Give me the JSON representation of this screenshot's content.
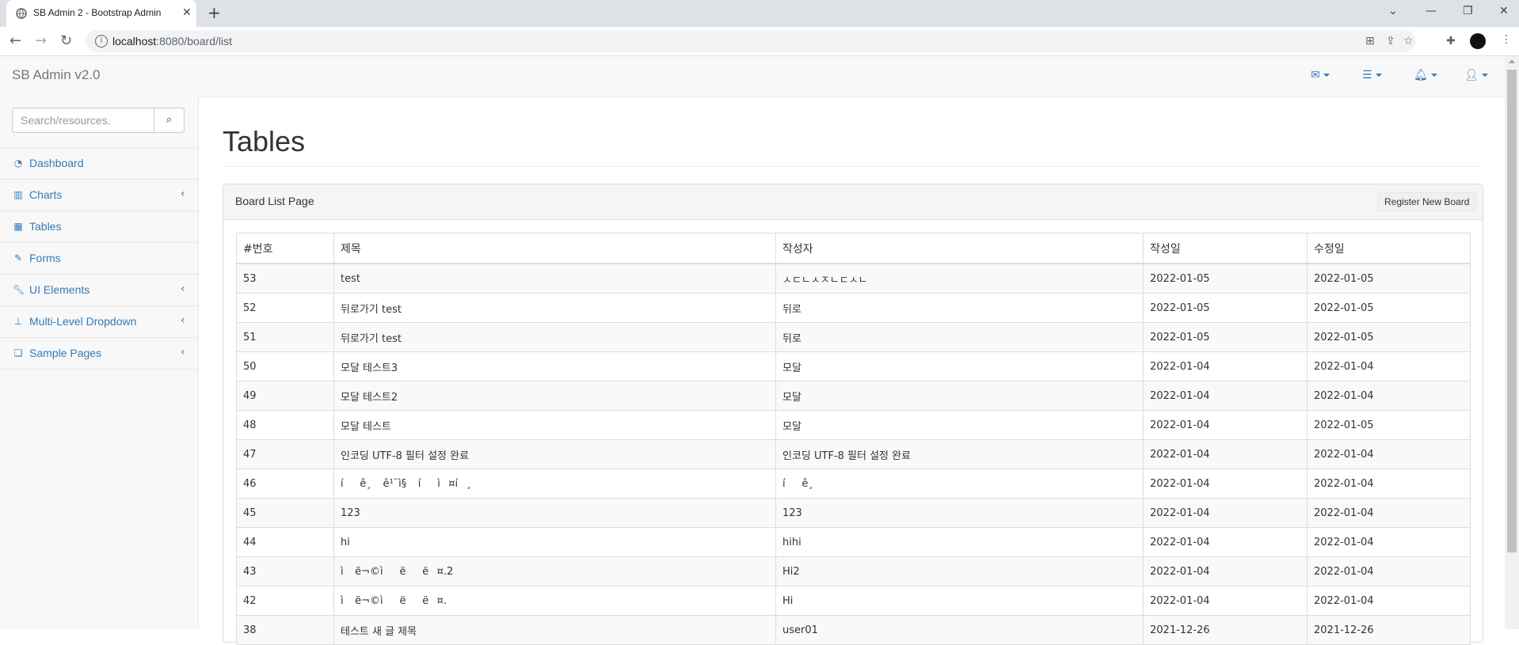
{
  "browser": {
    "tab_title": "SB Admin 2 - Bootstrap Admin",
    "url": "localhost:8080/board/list",
    "url_host": "localhost",
    "url_rest": ":8080/board/list"
  },
  "navbar": {
    "brand": "SB Admin v2.0",
    "icons": [
      "envelope-icon",
      "tasks-icon",
      "bell-icon",
      "user-icon"
    ]
  },
  "sidebar": {
    "search_placeholder": "Search/resources.",
    "items": [
      {
        "label": "Dashboard",
        "icon": "dashboard-icon",
        "has_arrow": false
      },
      {
        "label": "Charts",
        "icon": "bar-chart-icon",
        "has_arrow": true
      },
      {
        "label": "Tables",
        "icon": "table-icon",
        "has_arrow": false
      },
      {
        "label": "Forms",
        "icon": "edit-icon",
        "has_arrow": false
      },
      {
        "label": "UI Elements",
        "icon": "wrench-icon",
        "has_arrow": true
      },
      {
        "label": "Multi-Level Dropdown",
        "icon": "sitemap-icon",
        "has_arrow": true
      },
      {
        "label": "Sample Pages",
        "icon": "files-icon",
        "has_arrow": true
      }
    ]
  },
  "main": {
    "title": "Tables",
    "panel_title": "Board List Page",
    "register_button": "Register New Board",
    "table": {
      "headers": [
        "#번호",
        "제목",
        "작성자",
        "작성일",
        "수정일"
      ],
      "rows": [
        [
          "53",
          "test",
          "ㅅㄷㄴㅅㅈㄴㄷㅅㄴ",
          "2022-01-05",
          "2022-01-05"
        ],
        [
          "52",
          "뒤로가기 test",
          "뒤로",
          "2022-01-05",
          "2022-01-05"
        ],
        [
          "51",
          "뒤로가기 test",
          "뒤로",
          "2022-01-05",
          "2022-01-05"
        ],
        [
          "50",
          "모달 테스트3",
          "모달",
          "2022-01-04",
          "2022-01-04"
        ],
        [
          "49",
          "모달 테스트2",
          "모달",
          "2022-01-04",
          "2022-01-04"
        ],
        [
          "48",
          "모달 테스트",
          "모달",
          "2022-01-04",
          "2022-01-05"
        ],
        [
          "47",
          "인코딩 UTF-8 필터 설정 완료",
          "인코딩 UTF-8 필터 설정 완료",
          "2022-01-04",
          "2022-01-04"
        ],
        [
          "46",
          "íê¸ ê¹¨ì§ íì¤í¸",
          "íê¸",
          "2022-01-04",
          "2022-01-04"
        ],
        [
          "45",
          "123",
          "123",
          "2022-01-04",
          "2022-01-04"
        ],
        [
          "44",
          "hi",
          "hihi",
          "2022-01-04",
          "2022-01-04"
        ],
        [
          "43",
          "ì ë¬©ìëë¤.2",
          "Hi2",
          "2022-01-04",
          "2022-01-04"
        ],
        [
          "42",
          "ì ë¬©ìëë¤.",
          "Hi",
          "2022-01-04",
          "2022-01-04"
        ],
        [
          "38",
          "테스트 새 글 제목",
          "user01",
          "2021-12-26",
          "2021-12-26"
        ]
      ]
    }
  }
}
